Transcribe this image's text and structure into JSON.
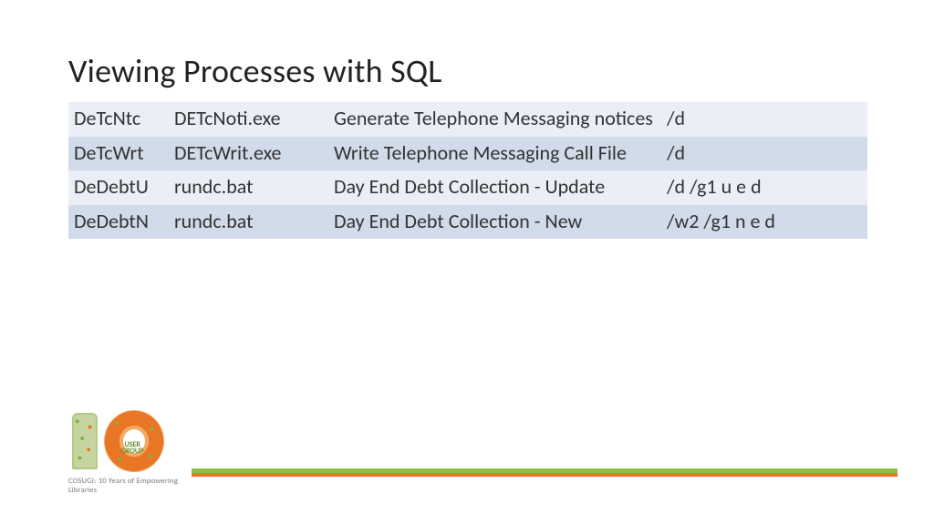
{
  "title": "Viewing Processes with SQL",
  "rows": [
    {
      "code": "DeTcNtc",
      "exe": "DETcNoti.exe",
      "desc": "Generate Telephone Messaging notices",
      "args": "/d"
    },
    {
      "code": "DeTcWrt",
      "exe": "DETcWrit.exe",
      "desc": "Write Telephone Messaging Call File",
      "args": "/d"
    },
    {
      "code": "DeDebtU",
      "exe": "rundc.bat",
      "desc": "Day End Debt Collection - Update",
      "args": "/d /g1 u e d"
    },
    {
      "code": "DeDebtN",
      "exe": "rundc.bat",
      "desc": "Day End Debt Collection - New",
      "args": "/w2 /g1 n e d"
    }
  ],
  "logo": {
    "user_group": "USER\nGROUP",
    "caption": "COSUGI: 10 Years of Empowering Libraries"
  }
}
